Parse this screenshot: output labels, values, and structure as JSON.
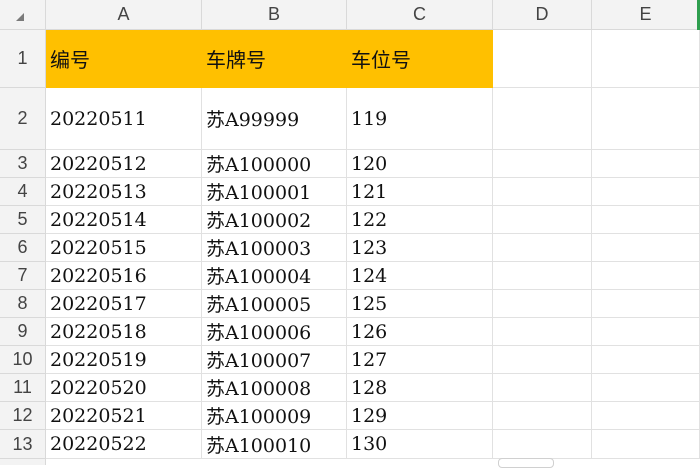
{
  "columns": [
    "A",
    "B",
    "C",
    "D",
    "E"
  ],
  "rows": [
    {
      "num": "1",
      "cells": [
        "编号",
        "车牌号",
        "车位号"
      ]
    },
    {
      "num": "2",
      "cells": [
        "20220511",
        "苏A99999",
        "119"
      ]
    },
    {
      "num": "3",
      "cells": [
        "20220512",
        "苏A100000",
        "120"
      ]
    },
    {
      "num": "4",
      "cells": [
        "20220513",
        "苏A100001",
        "121"
      ]
    },
    {
      "num": "5",
      "cells": [
        "20220514",
        "苏A100002",
        "122"
      ]
    },
    {
      "num": "6",
      "cells": [
        "20220515",
        "苏A100003",
        "123"
      ]
    },
    {
      "num": "7",
      "cells": [
        "20220516",
        "苏A100004",
        "124"
      ]
    },
    {
      "num": "8",
      "cells": [
        "20220517",
        "苏A100005",
        "125"
      ]
    },
    {
      "num": "9",
      "cells": [
        "20220518",
        "苏A100006",
        "126"
      ]
    },
    {
      "num": "10",
      "cells": [
        "20220519",
        "苏A100007",
        "127"
      ]
    },
    {
      "num": "11",
      "cells": [
        "20220520",
        "苏A100008",
        "128"
      ]
    },
    {
      "num": "12",
      "cells": [
        "20220521",
        "苏A100009",
        "129"
      ]
    },
    {
      "num": "13",
      "cells": [
        "20220522",
        "苏A100010",
        "130"
      ]
    }
  ],
  "colors": {
    "header_fill": "#ffc000",
    "header_bg": "#f3f3f3",
    "gridline": "#e1e1e1"
  }
}
